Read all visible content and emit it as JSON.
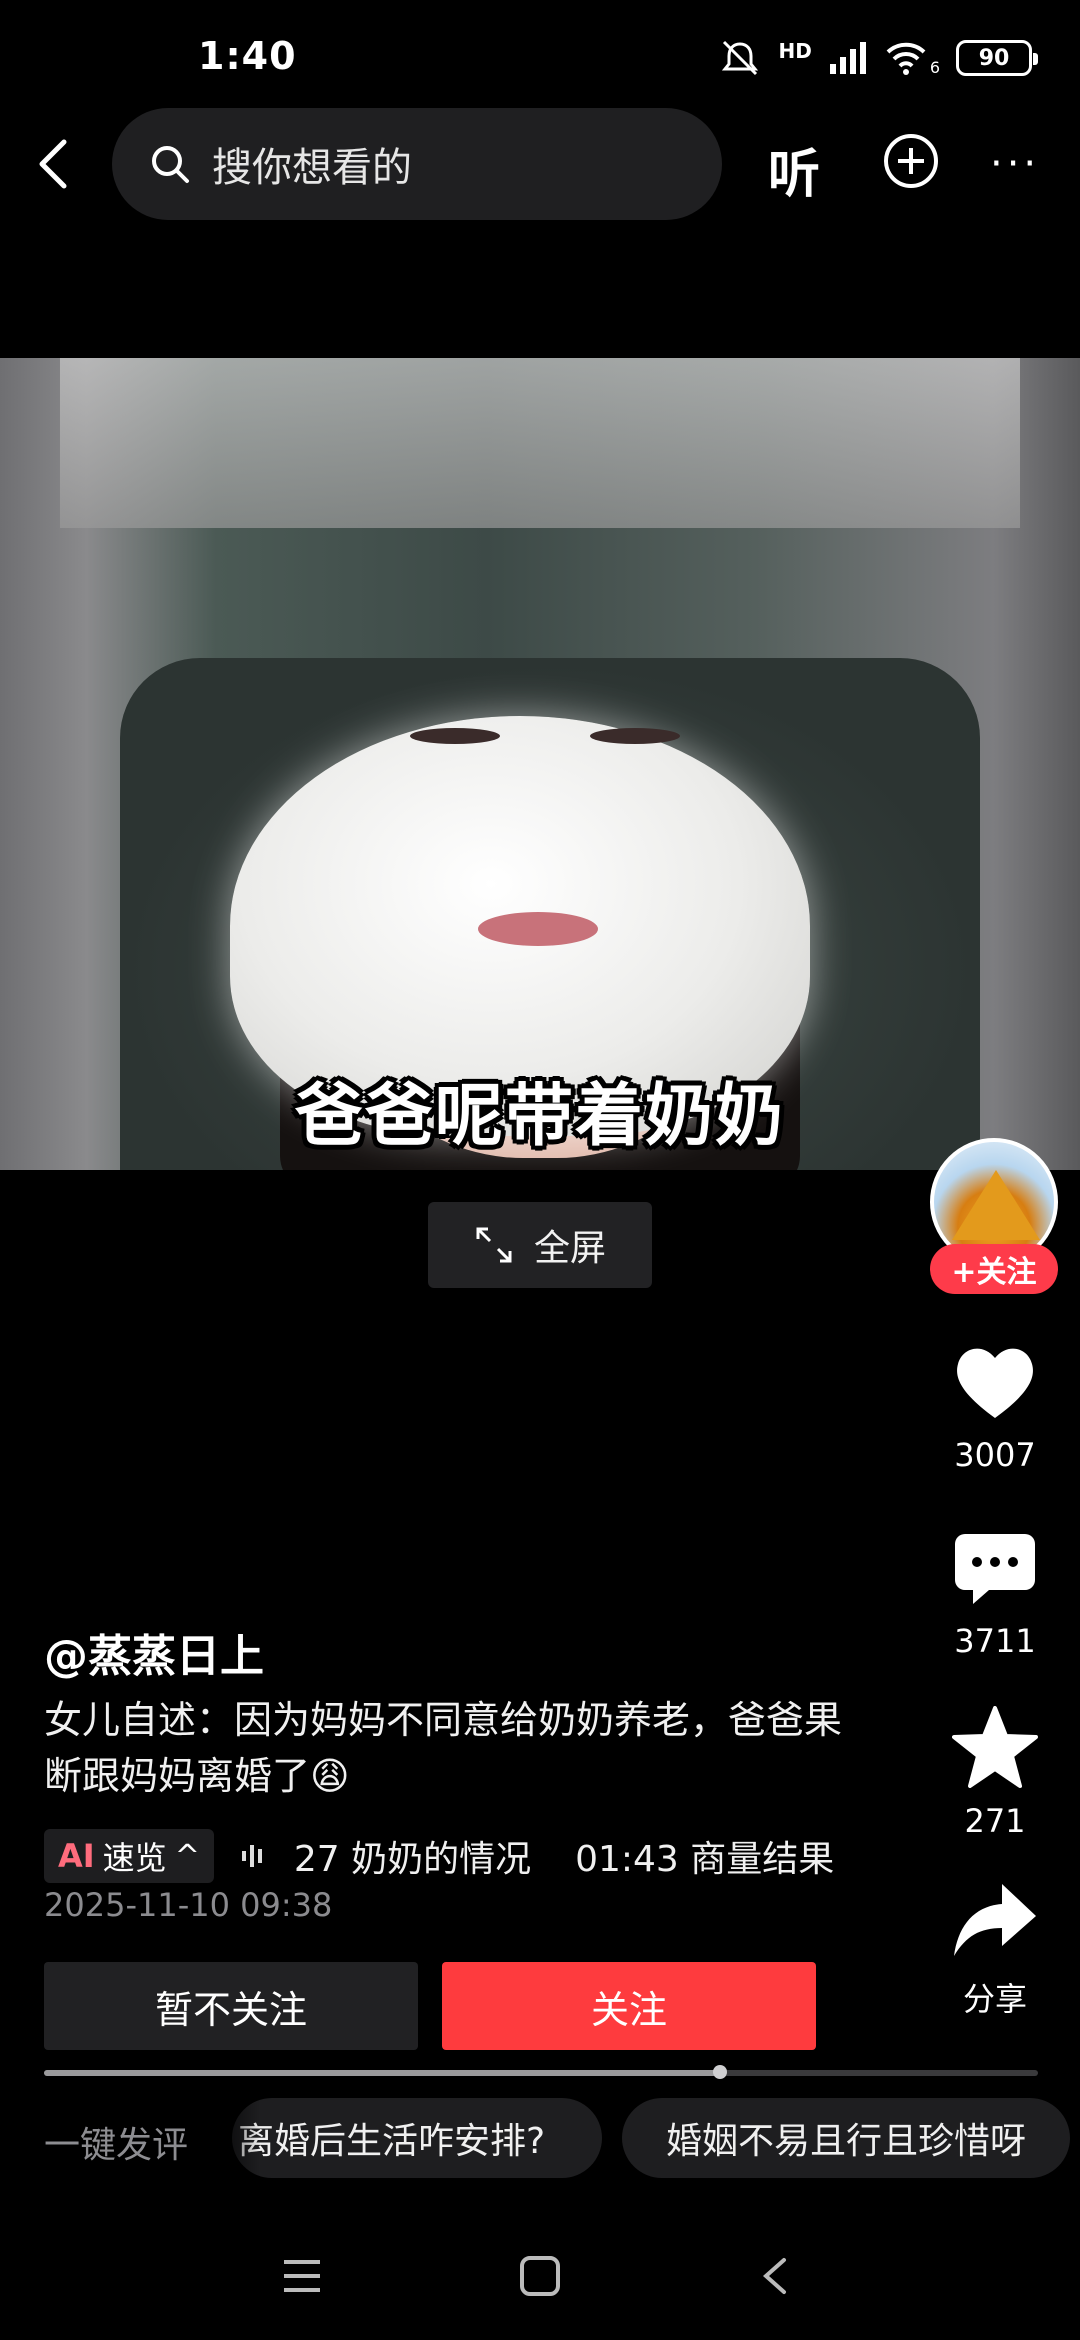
{
  "status_bar": {
    "time": "1:40",
    "network": "HD",
    "wifi_badge": "6",
    "battery": "90"
  },
  "header": {
    "search_placeholder": "搜你想看的",
    "listen_label": "听",
    "more_label": "···"
  },
  "video": {
    "subtitle": "爸爸呢带着奶奶",
    "fullscreen_label": "全屏"
  },
  "rail": {
    "follow_label": "+关注",
    "like_count": "3007",
    "comment_count": "3711",
    "favorite_count": "271",
    "share_label": "分享"
  },
  "post": {
    "author": "@蒸蒸日上",
    "description": "女儿自述：因为妈妈不同意给奶奶养老，爸爸果断跟妈妈离婚了😩",
    "ai_prefix": "AI",
    "ai_label": "速览",
    "ai_chevron": "^",
    "segment1": "27 奶奶的情况",
    "segment2": "01:43 商量结果",
    "date": "2025-11-10 09:38"
  },
  "actions": {
    "skip_label": "暂不关注",
    "follow_label": "关注"
  },
  "playback": {
    "progress": 0.68
  },
  "quick_comments": {
    "label": "一键发评",
    "chips": [
      "离婚后生活咋安排?",
      "婚姻不易且行且珍惜呀"
    ]
  },
  "colors": {
    "accent": "#fe3b3e",
    "chip_bg": "#1e1e20",
    "muted": "#8b8b8f"
  }
}
